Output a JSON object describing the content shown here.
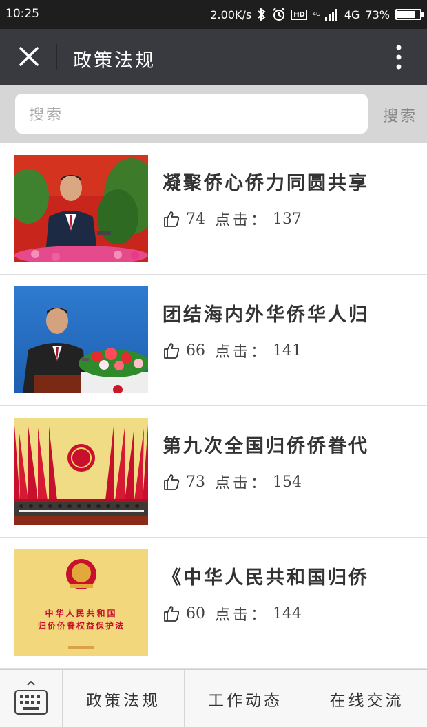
{
  "status_bar": {
    "time": "10:25",
    "net_speed": "2.00K/s",
    "hd": "HD",
    "signal_small": "4G",
    "network": "4G",
    "battery": "73%",
    "battery_level": 0.73
  },
  "header": {
    "title": "政策法规",
    "close_icon": "close-icon",
    "more_icon": "more-vertical-icon"
  },
  "search": {
    "placeholder": "搜索",
    "button_label": "搜索"
  },
  "articles": [
    {
      "title": "凝聚侨心侨力同圆共享",
      "likes": "74",
      "click_label": "点击：",
      "clicks": "137"
    },
    {
      "title": "团结海内外华侨华人归",
      "likes": "66",
      "click_label": "点击：",
      "clicks": "141"
    },
    {
      "title": "第九次全国归侨侨眷代",
      "likes": "73",
      "click_label": "点击：",
      "clicks": "154"
    },
    {
      "title": "《中华人民共和国归侨",
      "likes": "60",
      "click_label": "点击：",
      "clicks": "144"
    }
  ],
  "book_cover": {
    "line1": "中华人民共和国",
    "line2": "归侨侨眷权益保护法"
  },
  "tabbar": {
    "keyboard_icon": "keyboard-icon",
    "tabs": [
      "政策法规",
      "工作动态",
      "在线交流"
    ]
  },
  "colors": {
    "header_bg": "#393a3f",
    "status_bg": "#1e1e1e",
    "search_bg": "#d6d6d6"
  }
}
